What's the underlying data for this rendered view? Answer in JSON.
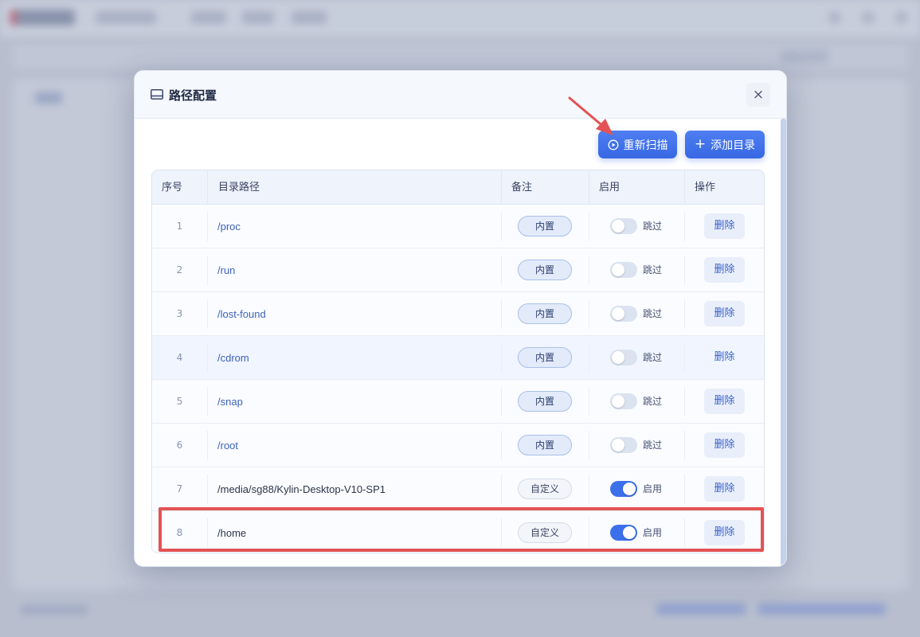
{
  "dialog": {
    "title": "路径配置",
    "close_symbol": "×",
    "rescan_label": "重新扫描",
    "add_label": "添加目录",
    "add_symbol": "+"
  },
  "table": {
    "headers": [
      "序号",
      "目录路径",
      "备注",
      "启用",
      "操作"
    ],
    "rows": [
      {
        "no": "1",
        "path": "/proc",
        "note": "内置",
        "enabled": false,
        "status": "跳过",
        "action": "删除"
      },
      {
        "no": "2",
        "path": "/run",
        "note": "内置",
        "enabled": false,
        "status": "跳过",
        "action": "删除"
      },
      {
        "no": "3",
        "path": "/lost-found",
        "note": "内置",
        "enabled": false,
        "status": "跳过",
        "action": "删除"
      },
      {
        "no": "4",
        "path": "/cdrom",
        "note": "内置",
        "enabled": false,
        "status": "跳过",
        "action": "删除"
      },
      {
        "no": "5",
        "path": "/snap",
        "note": "内置",
        "enabled": false,
        "status": "跳过",
        "action": "删除"
      },
      {
        "no": "6",
        "path": "/root",
        "note": "内置",
        "enabled": false,
        "status": "跳过",
        "action": "删除"
      },
      {
        "no": "7",
        "path": "/media/sg88/Kylin-Desktop-V10-SP1",
        "note": "自定义",
        "enabled": true,
        "status": "启用",
        "action": "删除"
      },
      {
        "no": "8",
        "path": "/home",
        "note": "自定义",
        "enabled": true,
        "status": "启用",
        "action": "删除"
      }
    ]
  },
  "colors": {
    "primary": "#3c70ea",
    "annotation": "#e35355"
  },
  "icons": {
    "title": "drive-icon",
    "rescan": "play-circle-icon",
    "add": "plus-icon",
    "close": "close-icon"
  }
}
